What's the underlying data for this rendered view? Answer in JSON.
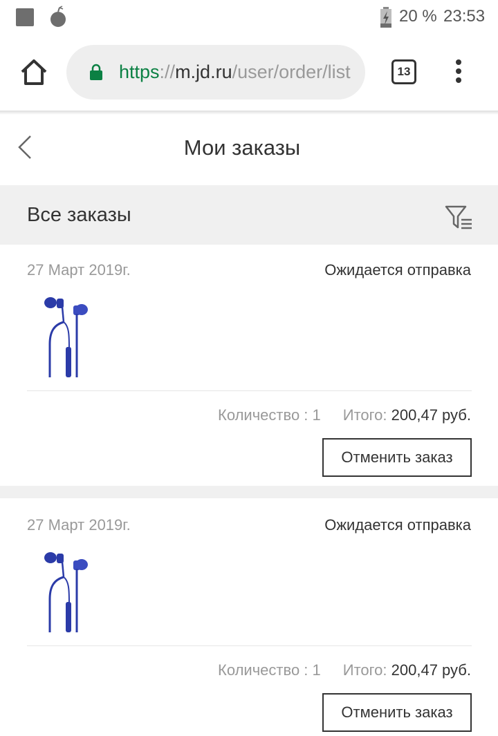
{
  "status_bar": {
    "battery_percent": "20 %",
    "time": "23:53"
  },
  "browser": {
    "url_scheme": "https",
    "url_separator": "://",
    "url_host": "m.jd.ru",
    "url_path": "/user/order/list",
    "tab_count": "13"
  },
  "page": {
    "title": "Мои заказы"
  },
  "filter": {
    "title": "Все заказы"
  },
  "orders": [
    {
      "date": "27 Март 2019г.",
      "status": "Ожидается отправка",
      "quantity": "Количество : 1",
      "total_label": "Итого:",
      "total_value": "200,47 руб.",
      "cancel_label": "Отменить заказ"
    },
    {
      "date": "27 Март 2019г.",
      "status": "Ожидается отправка",
      "quantity": "Количество : 1",
      "total_label": "Итого:",
      "total_value": "200,47 руб.",
      "cancel_label": "Отменить заказ"
    }
  ],
  "colors": {
    "secure_green": "#0b8043",
    "product_blue": "#2b3ba8",
    "band_gray": "#f0f0f0"
  }
}
